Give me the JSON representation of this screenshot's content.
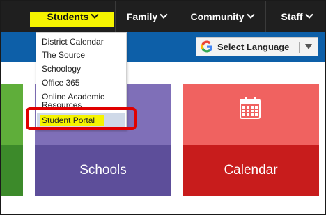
{
  "nav": {
    "items": [
      {
        "label": "Students",
        "icon": "chevron-down-icon"
      },
      {
        "label": "Family",
        "icon": "chevron-down-icon"
      },
      {
        "label": "Community",
        "icon": "chevron-down-icon"
      },
      {
        "label": "Staff",
        "icon": "chevron-down-icon"
      }
    ]
  },
  "language": {
    "label": "Select Language",
    "icon": "google-g-icon"
  },
  "dropdown": {
    "items": [
      {
        "label": "District Calendar"
      },
      {
        "label": "The Source"
      },
      {
        "label": "Schoology"
      },
      {
        "label": "Office 365"
      },
      {
        "label": "Online Academic Resources"
      },
      {
        "label": "Student Portal"
      }
    ]
  },
  "tiles": {
    "schools": {
      "label": "Schools"
    },
    "calendar": {
      "label": "Calendar",
      "icon": "calendar-icon"
    }
  },
  "colors": {
    "nav_bg": "#1f1f1f",
    "blue_bar": "#0d5fa8",
    "highlight": "#f5f400",
    "annotation_red": "#e00000",
    "schools_tile": "#5d4e9a",
    "calendar_tile": "#c81c1c",
    "green_tile": "#3c8a2a"
  }
}
